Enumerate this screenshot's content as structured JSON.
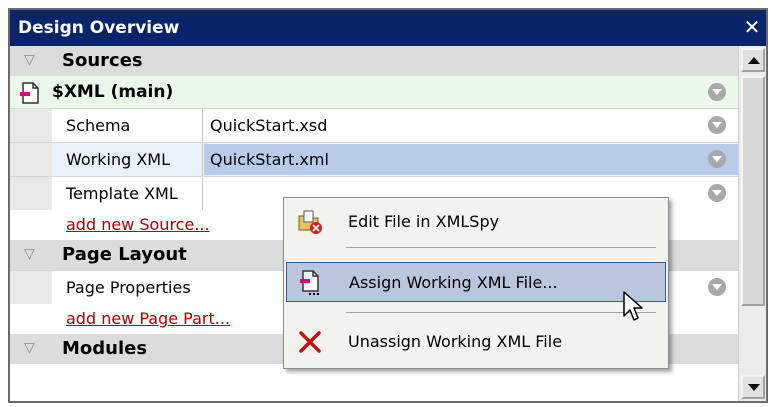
{
  "window": {
    "title": "Design Overview",
    "close_glyph": "✕"
  },
  "sections": {
    "sources": {
      "label": "Sources",
      "toggle_glyph": "▽"
    },
    "page_layout": {
      "label": "Page Layout",
      "toggle_glyph": "▽"
    },
    "modules": {
      "label": "Modules",
      "toggle_glyph": "▽"
    }
  },
  "source_main": {
    "label": "$XML (main)",
    "icon": "xml-document-icon"
  },
  "properties": [
    {
      "name": "Schema",
      "value": "QuickStart.xsd"
    },
    {
      "name": "Working XML",
      "value": "QuickStart.xml"
    },
    {
      "name": "Template XML",
      "value": ""
    }
  ],
  "links": {
    "add_source": "add new Source...",
    "add_page_part": "add new Page Part..."
  },
  "page_properties": {
    "name": "Page Properties"
  },
  "context_menu": {
    "items": [
      {
        "label": "Edit File in XMLSpy",
        "icon": "edit-file-icon"
      },
      {
        "label": "Assign Working XML File...",
        "icon": "assign-file-icon"
      },
      {
        "label": "Unassign Working XML File",
        "icon": "unassign-x-icon"
      }
    ]
  },
  "colors": {
    "titlebar": "#0a246a",
    "section_bg": "#dcdcdc",
    "selected_value_bg": "#b7cce9",
    "menu_hover": "#b9c6de",
    "link": "#b00000"
  }
}
